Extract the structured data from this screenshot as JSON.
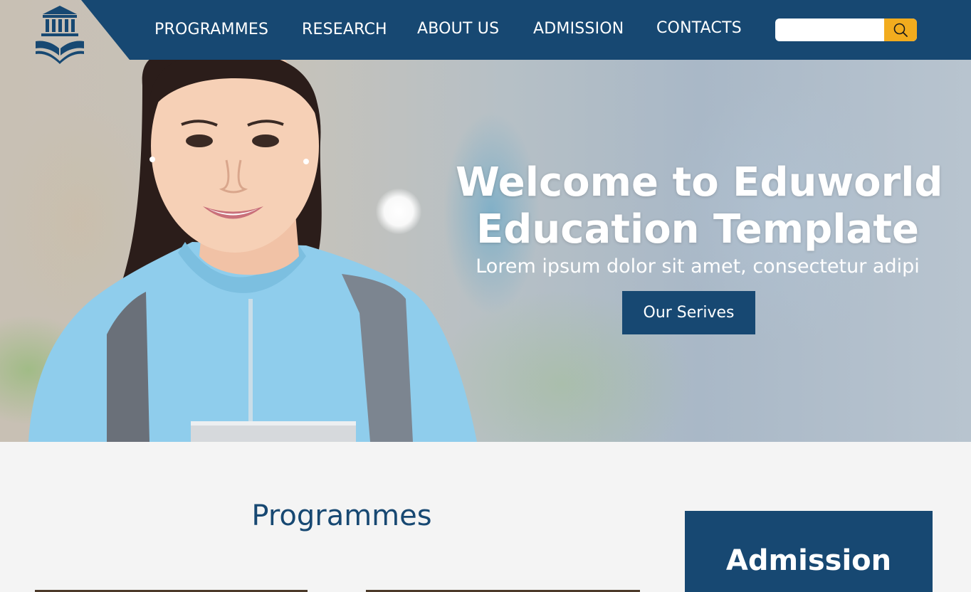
{
  "nav": {
    "items": [
      {
        "label": "PROGRAMMES"
      },
      {
        "label": "RESEARCH"
      },
      {
        "label": "ABOUT US"
      },
      {
        "label": "ADMISSION"
      },
      {
        "label": "CONTACTS"
      }
    ]
  },
  "search": {
    "value": "",
    "placeholder": "",
    "icon": "search-icon"
  },
  "logo": {
    "icon": "university-book-icon"
  },
  "hero": {
    "title_line1": "Welcome to Eduworld",
    "title_line2": "Education Template",
    "subtitle": "Lorem ipsum dolor sit amet, consectetur adipi",
    "button_label": "Our Serives"
  },
  "programmes": {
    "title": "Programmes"
  },
  "admission": {
    "title": "Admission"
  },
  "colors": {
    "primary": "#174872",
    "accent": "#f2ac1e",
    "background": "#f4f4f4",
    "text_light": "#ffffff"
  }
}
